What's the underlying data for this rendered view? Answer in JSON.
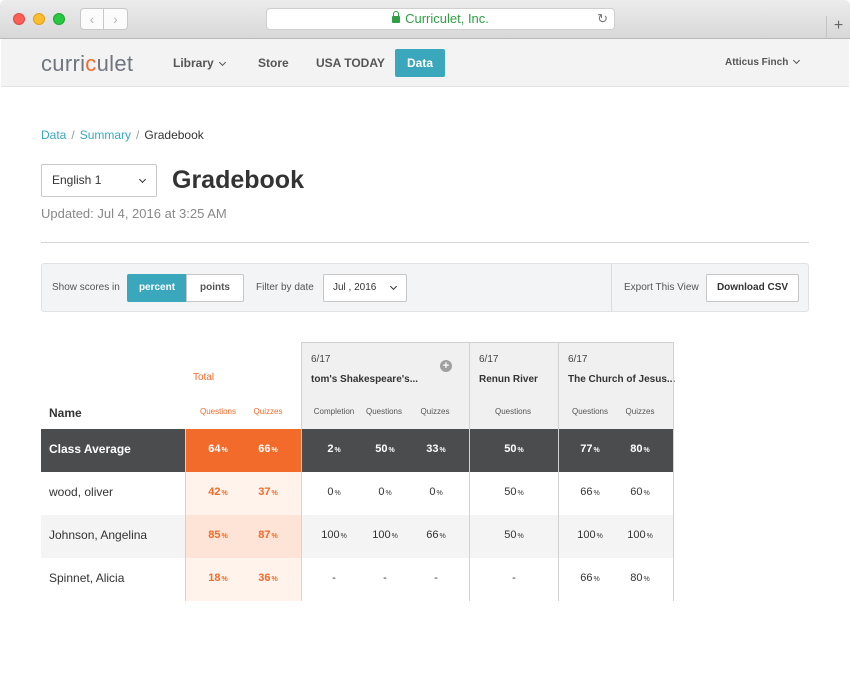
{
  "browser": {
    "url_text": "Curriculet, Inc.",
    "back_glyph": "‹",
    "forward_glyph": "›",
    "reload_glyph": "↻",
    "newtab_glyph": "+"
  },
  "header": {
    "logo_pre": "curri",
    "logo_accent": "c",
    "logo_post": "ulet",
    "nav": {
      "library": "Library",
      "store": "Store",
      "usa_today": "USA TODAY",
      "data": "Data"
    },
    "user": "Atticus Finch"
  },
  "breadcrumb": {
    "data": "Data",
    "summary": "Summary",
    "current": "Gradebook",
    "separator": "/"
  },
  "class_select": {
    "value": "English 1"
  },
  "page_title": "Gradebook",
  "updated": "Updated: Jul 4, 2016 at 3:25 AM",
  "filters": {
    "show_scores_label": "Show scores in",
    "percent": "percent",
    "points": "points",
    "filter_by_date_label": "Filter by date",
    "date_value": "Jul , 2016",
    "export_label": "Export This View",
    "download_csv": "Download CSV"
  },
  "table": {
    "name_header": "Name",
    "total_label": "Total",
    "total_sub": [
      "Questions",
      "Quizzes"
    ],
    "groups": [
      {
        "date": "6/17",
        "title": "tom's Shakespeare's...",
        "sub": [
          "Completion",
          "Questions",
          "Quizzes"
        ]
      },
      {
        "date": "6/17",
        "title": "Renun River",
        "sub": [
          "Questions"
        ]
      },
      {
        "date": "6/17",
        "title": "The Church of Jesus...",
        "sub": [
          "Questions",
          "Quizzes"
        ]
      }
    ],
    "pct_sign": "%",
    "rows": [
      {
        "name": "Class Average",
        "total": [
          "64",
          "66"
        ],
        "g1": [
          "2",
          "50",
          "33"
        ],
        "g2": [
          "50"
        ],
        "g3": [
          "77",
          "80"
        ]
      },
      {
        "name": "wood, oliver",
        "total": [
          "42",
          "37"
        ],
        "g1": [
          "0",
          "0",
          "0"
        ],
        "g2": [
          "50"
        ],
        "g3": [
          "66",
          "60"
        ]
      },
      {
        "name": "Johnson, Angelina",
        "total": [
          "85",
          "87"
        ],
        "g1": [
          "100",
          "100",
          "66"
        ],
        "g2": [
          "50"
        ],
        "g3": [
          "100",
          "100"
        ]
      },
      {
        "name": "Spinnet, Alicia",
        "total": [
          "18",
          "36"
        ],
        "g1": [
          "-",
          "-",
          "-"
        ],
        "g2": [
          "-"
        ],
        "g3": [
          "66",
          "80"
        ]
      }
    ]
  },
  "colors": {
    "accent_teal": "#3aa7bd",
    "accent_orange": "#f26b2a",
    "avg_row_bg": "#4b4c4e"
  }
}
